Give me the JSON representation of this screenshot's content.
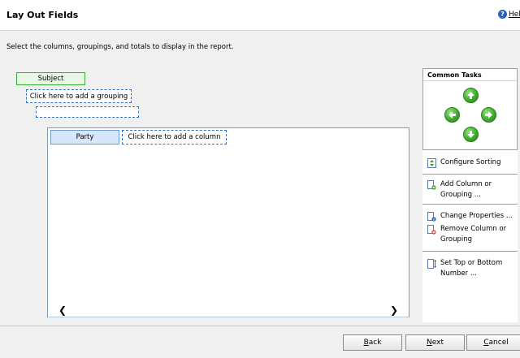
{
  "header": {
    "title": "Lay Out Fields",
    "help_label": "Help"
  },
  "instruction": "Select the columns, groupings, and totals to display in the report.",
  "groupings": {
    "subject": "Subject",
    "add_grouping": "Click here to add a grouping"
  },
  "columns": {
    "party": "Party",
    "add_column": "Click here to add a column"
  },
  "common_tasks": {
    "title": "Common Tasks",
    "move_arrows": [
      "arrow-up-icon",
      "arrow-left-icon",
      "arrow-right-icon",
      "arrow-down-icon"
    ],
    "configure_sorting": "Configure Sorting",
    "add_column_line1": "Add Column or",
    "add_column_line2": "Grouping ...",
    "change_properties": "Change Properties ...",
    "remove_column_line1": "Remove Column or",
    "remove_column_line2": "Grouping",
    "set_top_bottom_line1": "Set Top or Bottom",
    "set_top_bottom_line2": "Number ..."
  },
  "footer": {
    "back_mnemonic": "B",
    "back_rest": "ack",
    "next_mnemonic": "N",
    "next_rest": "ext",
    "cancel_mnemonic": "C",
    "cancel_rest": "ancel"
  },
  "colors": {
    "accent_green": "#3fae2b",
    "selection_blue": "#d6e7fb",
    "dashed_border": "#2f6fbf"
  }
}
